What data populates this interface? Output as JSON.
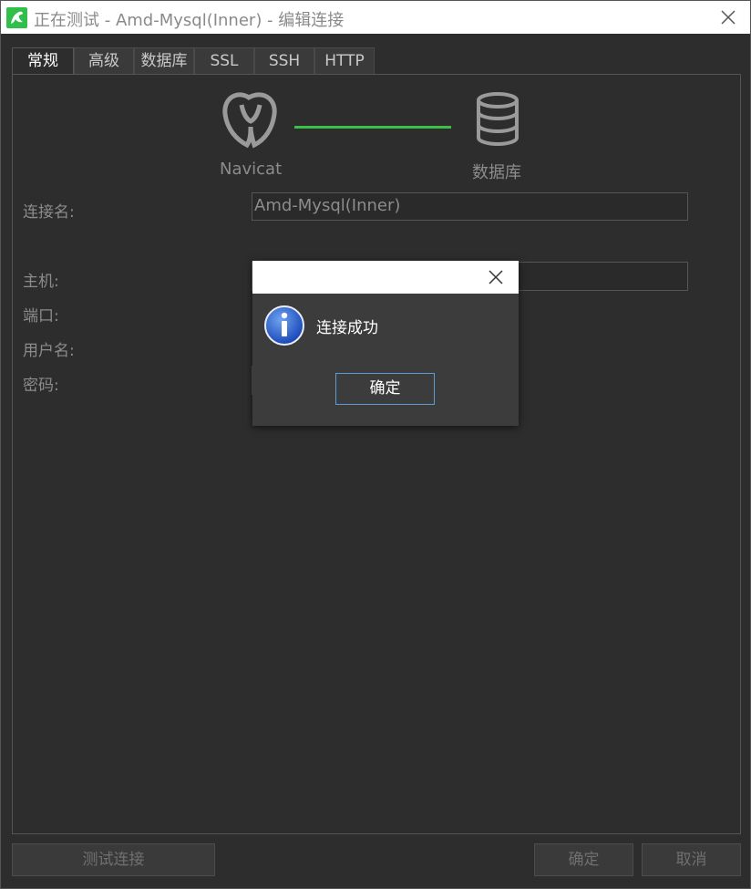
{
  "window": {
    "title": "正在测试 - Amd-Mysql(Inner) - 编辑连接",
    "app_icon": "navicat-dolphin-icon",
    "close_icon": "close-icon"
  },
  "tabs": [
    {
      "label": "常规",
      "active": true
    },
    {
      "label": "高级"
    },
    {
      "label": "数据库"
    },
    {
      "label": "SSL"
    },
    {
      "label": "SSH"
    },
    {
      "label": "HTTP"
    }
  ],
  "diagram": {
    "left_label": "Navicat",
    "right_label": "数据库",
    "line_color": "#3bbf46"
  },
  "form": {
    "conn_name_label": "连接名:",
    "conn_name_value": "Amd-Mysql(Inner)",
    "host_label": "主机:",
    "port_label": "端口:",
    "user_label": "用户名:",
    "password_label": "密码:"
  },
  "buttons": {
    "test": "测试连接",
    "ok": "确定",
    "cancel": "取消"
  },
  "dialog": {
    "message": "连接成功",
    "ok": "确定",
    "icon": "info-icon"
  }
}
